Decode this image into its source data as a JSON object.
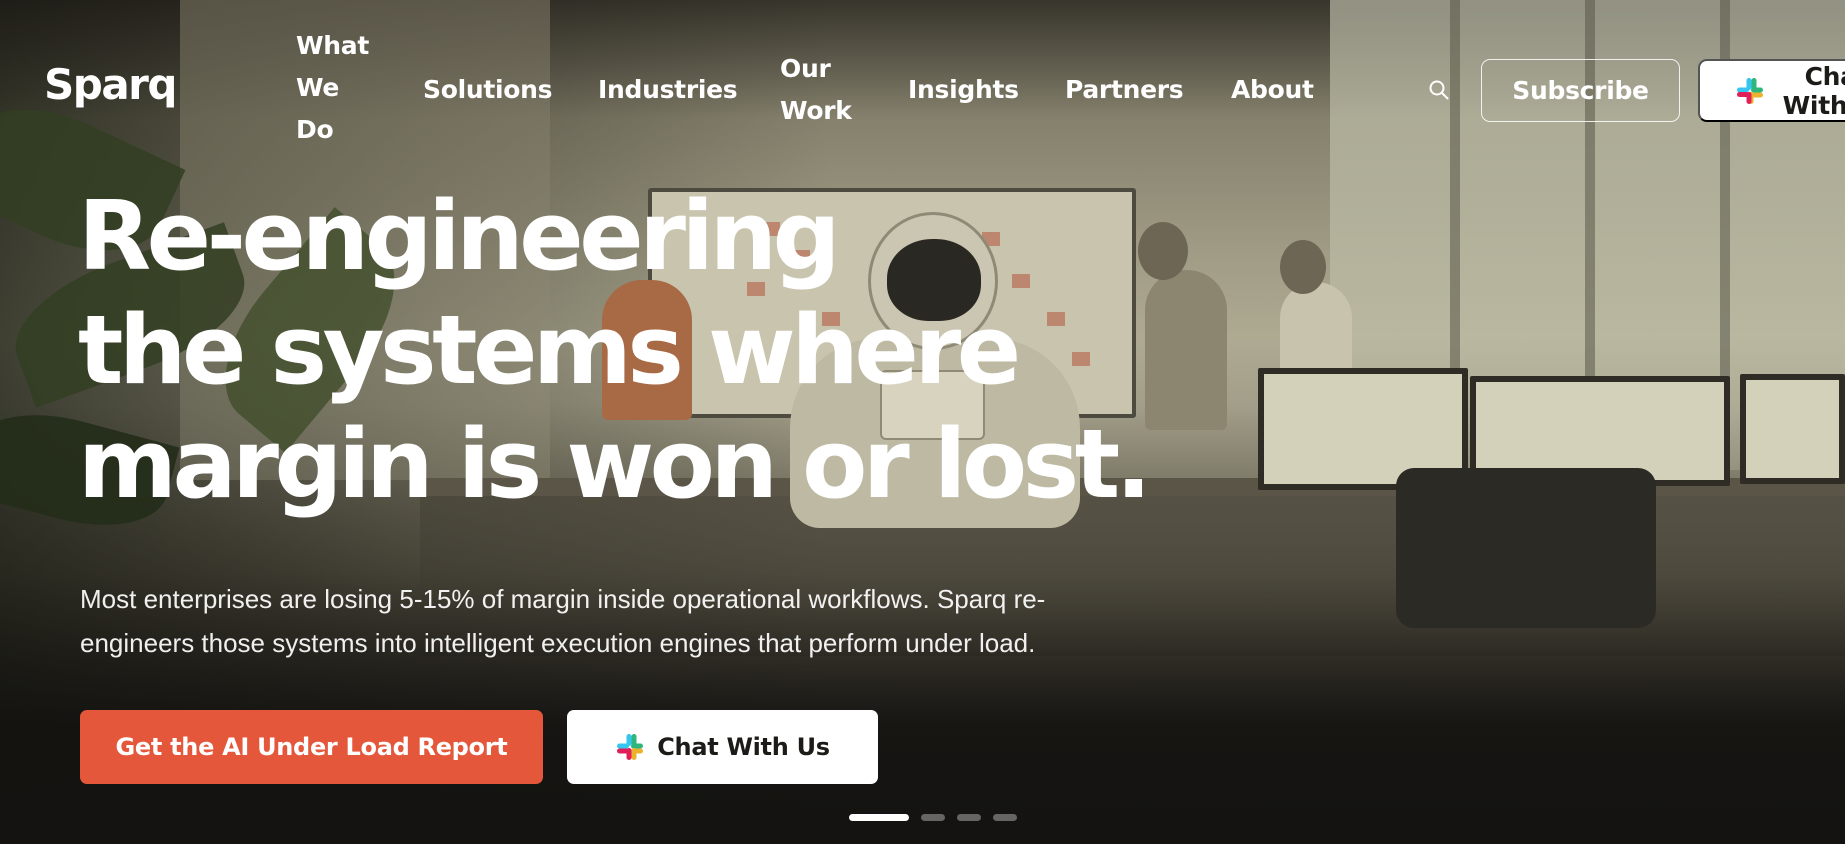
{
  "brand": {
    "logo_text": "Sparq",
    "accent_color": "#e4573a"
  },
  "nav": {
    "items": [
      {
        "label": "What We Do"
      },
      {
        "label": "Solutions"
      },
      {
        "label": "Industries"
      },
      {
        "label": "Our Work"
      },
      {
        "label": "Insights"
      },
      {
        "label": "Partners"
      },
      {
        "label": "About"
      }
    ],
    "search_icon": "search-icon",
    "subscribe_label": "Subscribe",
    "chat_label": "Chat With Us",
    "chat_icon": "slack-icon"
  },
  "hero": {
    "headline_lines": [
      "Re-engineering",
      "the systems where",
      "margin is won or lost."
    ],
    "subtext": "Most enterprises are losing 5-15% of margin inside operational workflows. Sparq re-engineers those systems into intelligent execution engines that perform under load.",
    "primary_cta": "Get the AI Under Load Report",
    "secondary_cta": "Chat With Us",
    "secondary_cta_icon": "slack-icon"
  },
  "carousel": {
    "slide_count": 4,
    "active_index": 0
  }
}
